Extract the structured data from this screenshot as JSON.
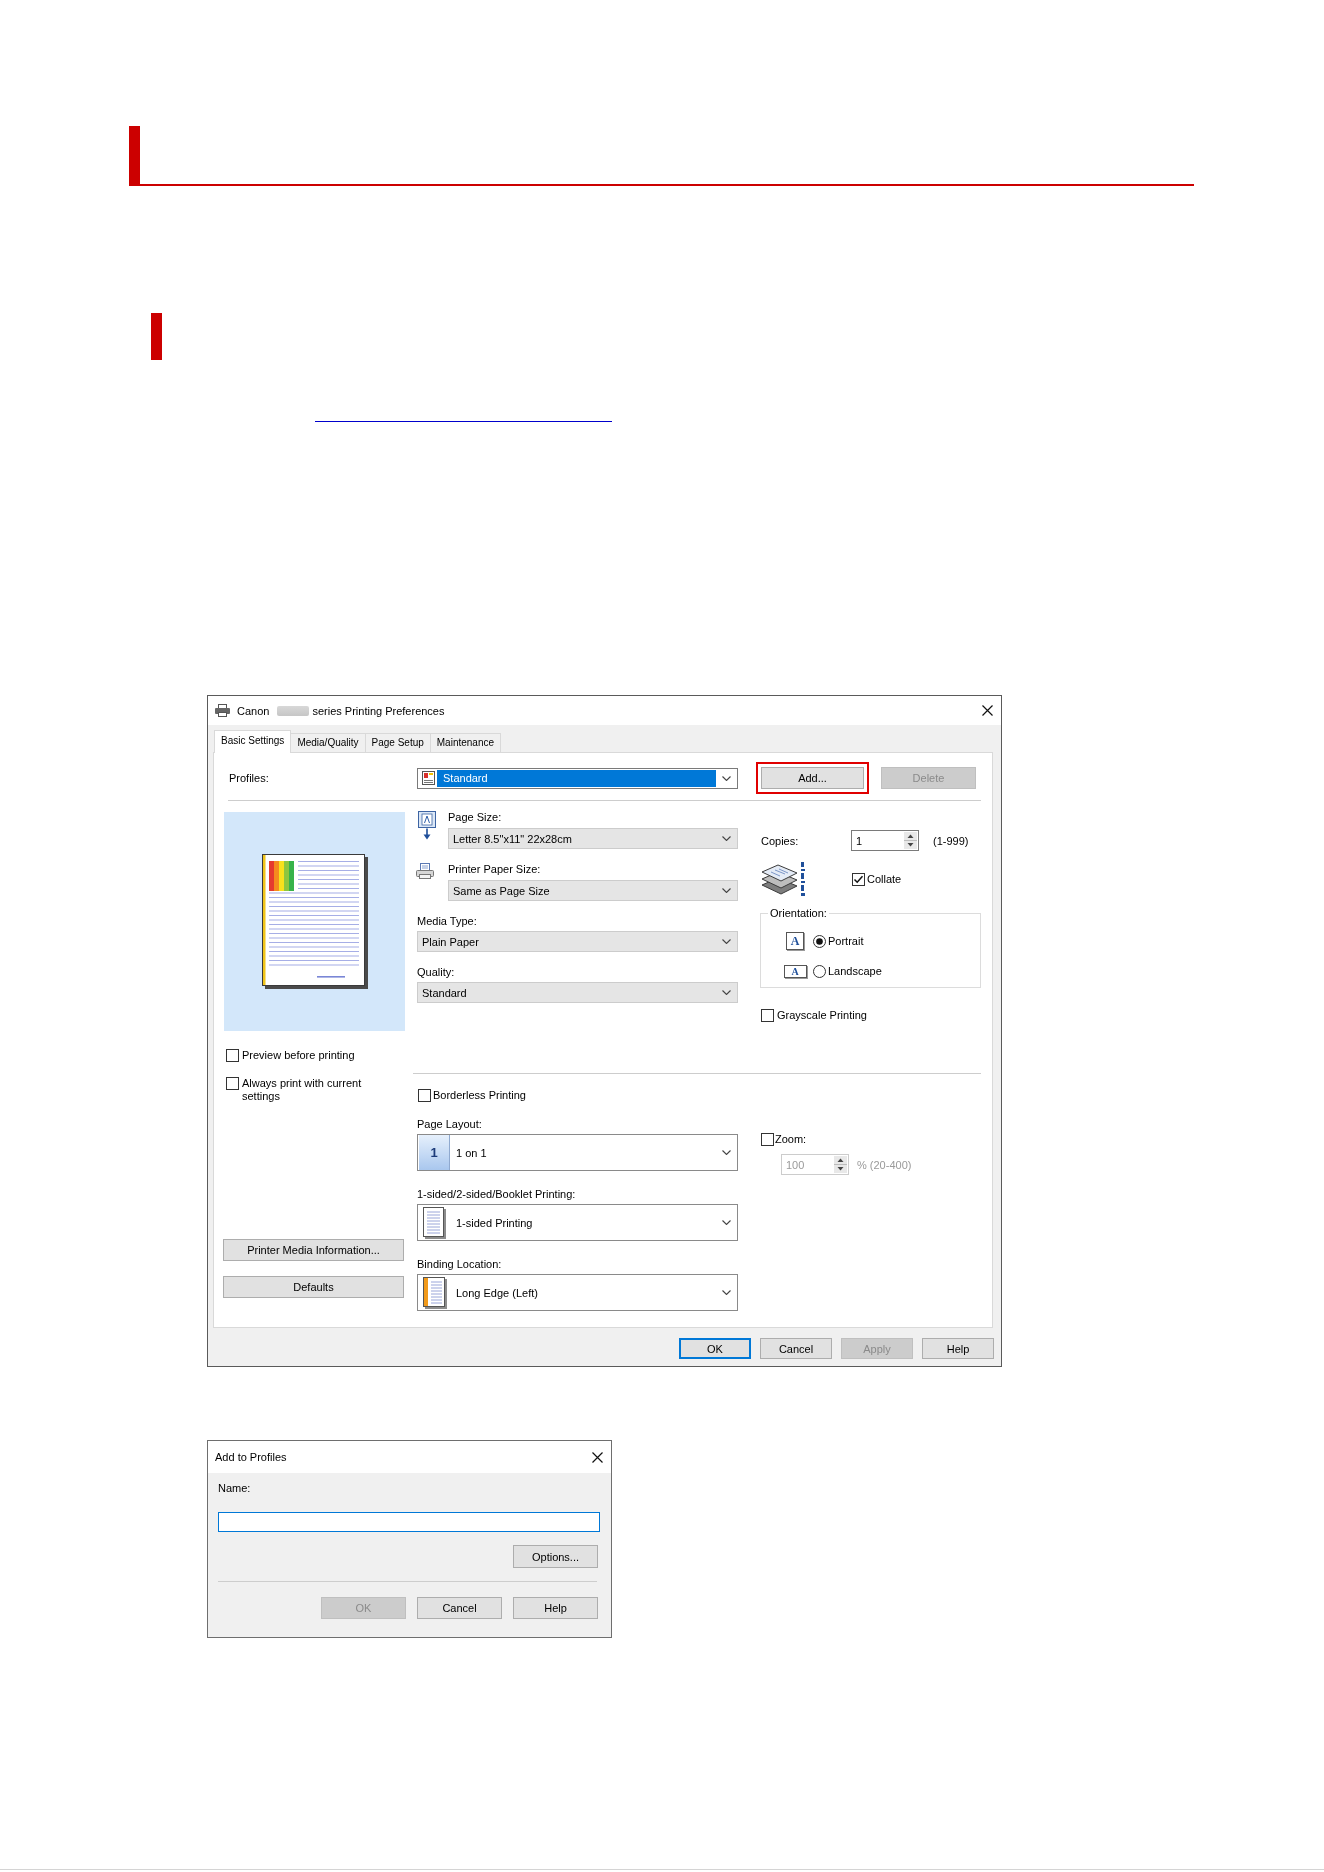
{
  "dialog": {
    "title_prefix": "Canon",
    "title_suffix": "series Printing Preferences",
    "tabs": [
      {
        "label": "Basic Settings",
        "selected": true
      },
      {
        "label": "Media/Quality",
        "selected": false
      },
      {
        "label": "Page Setup",
        "selected": false
      },
      {
        "label": "Maintenance",
        "selected": false
      }
    ],
    "profiles": {
      "label": "Profiles:",
      "value": "Standard",
      "focused": true
    },
    "profile_buttons": [
      {
        "label": "Add...",
        "disabled": false,
        "highlighted": true
      },
      {
        "label": "Delete",
        "disabled": true,
        "highlighted": false
      }
    ],
    "preview_options": [
      {
        "label": "Preview before printing",
        "checked": false
      },
      {
        "label": "Always print with current settings",
        "checked": false
      }
    ],
    "side_buttons": [
      "Printer Media Information...",
      "Defaults"
    ],
    "paper_settings": [
      {
        "kind": "pagesize",
        "label": "Page Size:",
        "value": "Letter 8.5\"x11\" 22x28cm"
      },
      {
        "kind": "printer",
        "label": "Printer Paper Size:",
        "value": "Same as Page Size"
      },
      {
        "kind": "plain",
        "label": "Media Type:",
        "value": "Plain Paper"
      },
      {
        "kind": "plain",
        "label": "Quality:",
        "value": "Standard"
      }
    ],
    "copies": {
      "label": "Copies:",
      "value": "1",
      "range": "(1-999)"
    },
    "collate": {
      "label": "Collate",
      "checked": true
    },
    "orientation": {
      "label": "Orientation:",
      "options": [
        {
          "label": "Portrait",
          "icon_letter": "A",
          "selected": true
        },
        {
          "label": "Landscape",
          "icon_letter": "A",
          "selected": false
        }
      ]
    },
    "grayscale": {
      "label": "Grayscale Printing",
      "checked": false
    },
    "borderless": {
      "label": "Borderless Printing",
      "checked": false
    },
    "layout_settings": [
      {
        "kind": "tile",
        "label": "Page Layout:",
        "value": "1 on 1",
        "icon_text": "1"
      },
      {
        "kind": "sheet",
        "label": "1-sided/2-sided/Booklet Printing:",
        "value": "1-sided Printing"
      },
      {
        "kind": "binding",
        "label": "Binding Location:",
        "value": "Long Edge (Left)"
      }
    ],
    "zoom": {
      "label": "Zoom:",
      "checked": false,
      "value": "100",
      "range": "% (20-400)",
      "disabled": true
    },
    "footer_buttons": [
      {
        "label": "OK",
        "focused": true,
        "disabled": false
      },
      {
        "label": "Cancel",
        "focused": false,
        "disabled": false
      },
      {
        "label": "Apply",
        "focused": false,
        "disabled": true
      },
      {
        "label": "Help",
        "focused": false,
        "disabled": false
      }
    ]
  },
  "add_dialog": {
    "title": "Add to Profiles",
    "name_label": "Name:",
    "name_focused": true,
    "options_button": "Options...",
    "footer_buttons": [
      {
        "label": "OK",
        "disabled": true
      },
      {
        "label": "Cancel",
        "disabled": false
      },
      {
        "label": "Help",
        "disabled": false
      }
    ]
  }
}
